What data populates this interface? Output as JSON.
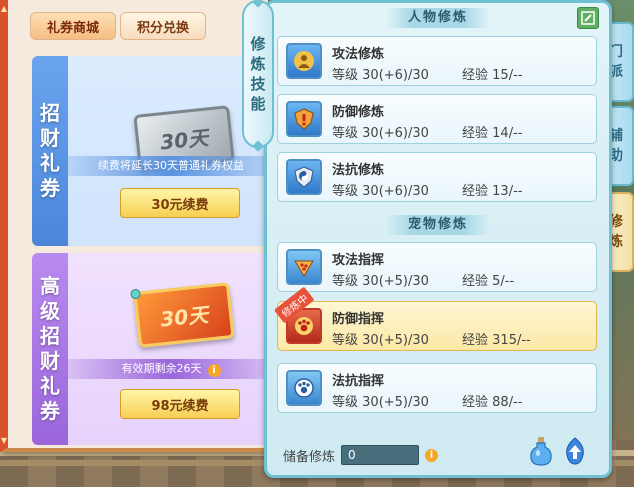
{
  "shop": {
    "tabs": [
      {
        "label": "礼券商城",
        "active": true
      },
      {
        "label": "积分兑换",
        "active": false
      }
    ],
    "cards": [
      {
        "side_title": "招财礼券",
        "ticket_text": "30天",
        "note": "续费将延长30天普通礼券权益",
        "button_label": "30元续费"
      },
      {
        "side_title": "高级招财礼券",
        "ticket_text": "30天",
        "note": "有效期剩余26天",
        "button_label": "98元续费"
      }
    ]
  },
  "panel": {
    "vertical_tab": "修炼技能",
    "right_tabs": [
      {
        "label": "门派",
        "active": false
      },
      {
        "label": "辅助",
        "active": false
      },
      {
        "label": "修炼",
        "active": true
      }
    ],
    "sections": [
      {
        "title": "人物修炼"
      },
      {
        "title": "宠物修炼"
      }
    ],
    "skills": [
      {
        "name": "攻法修炼",
        "level_label": "等级",
        "level": "30(+6)/30",
        "exp_label": "经验",
        "exp": "15/--",
        "icon": "attack-magic-icon",
        "selected": false
      },
      {
        "name": "防御修炼",
        "level_label": "等级",
        "level": "30(+6)/30",
        "exp_label": "经验",
        "exp": "14/--",
        "icon": "defense-icon",
        "selected": false
      },
      {
        "name": "法抗修炼",
        "level_label": "等级",
        "level": "30(+6)/30",
        "exp_label": "经验",
        "exp": "13/--",
        "icon": "magic-resist-icon",
        "selected": false
      },
      {
        "name": "攻法指挥",
        "level_label": "等级",
        "level": "30(+5)/30",
        "exp_label": "经验",
        "exp": "5/--",
        "icon": "pet-attack-icon",
        "selected": false
      },
      {
        "name": "防御指挥",
        "level_label": "等级",
        "level": "30(+5)/30",
        "exp_label": "经验",
        "exp": "315/--",
        "icon": "pet-defense-icon",
        "selected": true,
        "badge": "修炼中"
      },
      {
        "name": "法抗指挥",
        "level_label": "等级",
        "level": "30(+5)/30",
        "exp_label": "经验",
        "exp": "88/--",
        "icon": "pet-resist-icon",
        "selected": false
      }
    ],
    "reserve": {
      "label": "储备修炼",
      "value": "0"
    },
    "colors": {
      "panel_border": "#6fc0d2",
      "selected_bg": "#fbe8a6",
      "accent_red": "#d9532a"
    }
  }
}
